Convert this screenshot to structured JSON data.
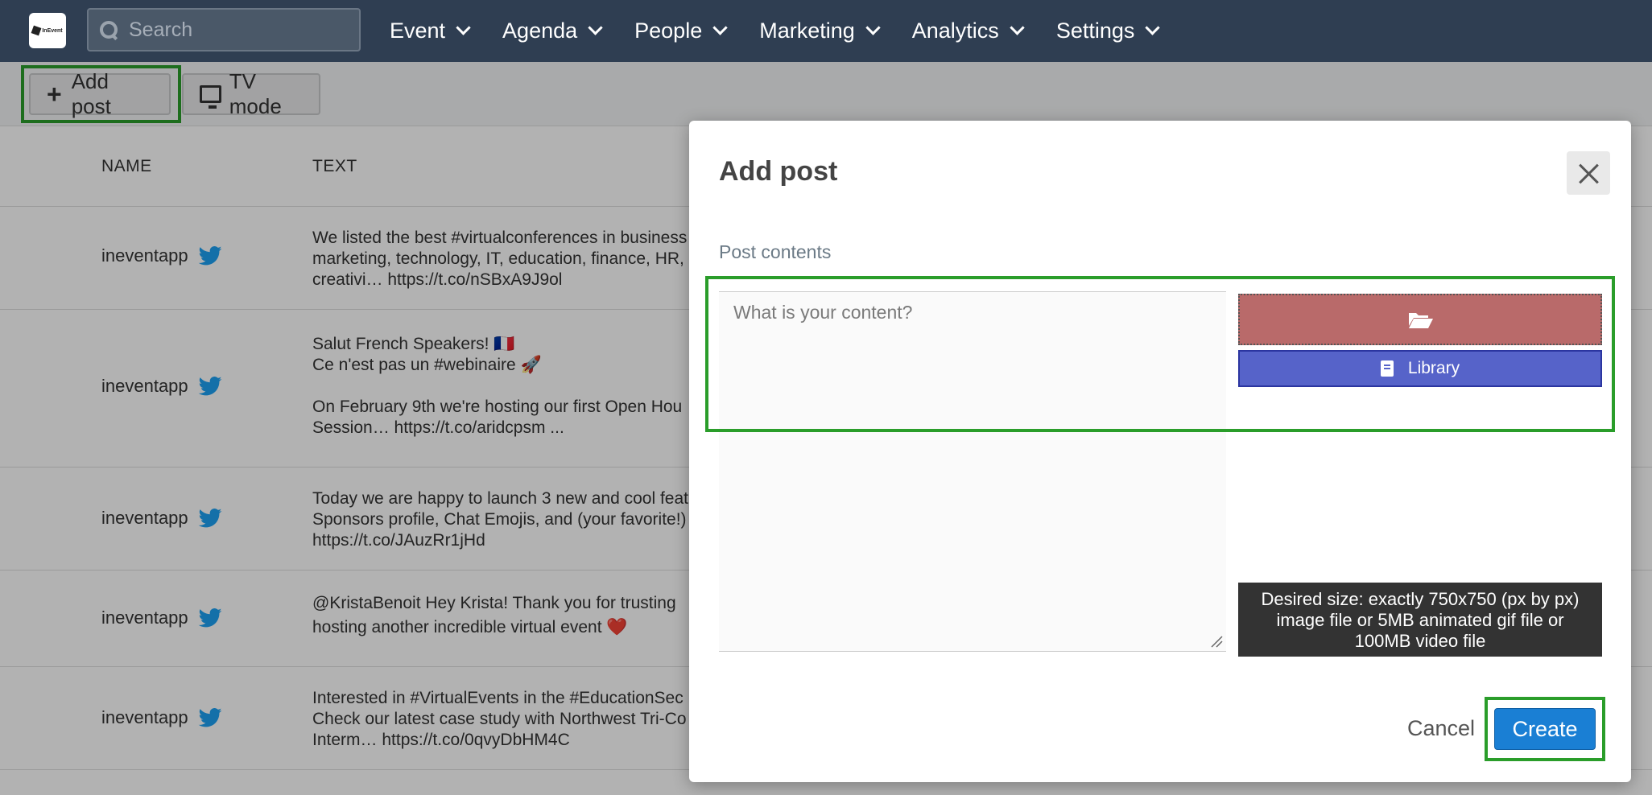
{
  "header": {
    "logo_text": "InEvent",
    "search_placeholder": "Search",
    "nav": [
      "Event",
      "Agenda",
      "People",
      "Marketing",
      "Analytics",
      "Settings"
    ]
  },
  "toolbar": {
    "add_post_label": "Add post",
    "tv_mode_label": "TV mode"
  },
  "table": {
    "columns": [
      "NAME",
      "TEXT"
    ],
    "rows": [
      {
        "name": "ineventapp",
        "text": "We listed the best #virtualconferences in business\nmarketing, technology, IT, education, finance, HR,\ncreativi… https://t.co/nSBxA9J9ol"
      },
      {
        "name": "ineventapp",
        "text": "Salut French Speakers! 🇫🇷\nCe n'est pas un #webinaire 🚀\n\nOn February 9th we're hosting our first Open Hou\nSession… https://t.co/aridcpsm ..."
      },
      {
        "name": "ineventapp",
        "text": "Today we are happy to launch 3 new and cool feat\nSponsors profile, Chat Emojis, and (your favorite!)\nhttps://t.co/JAuzRr1jHd"
      },
      {
        "name": "ineventapp",
        "text": "@KristaBenoit Hey Krista! Thank you for trusting\nhosting another incredible virtual event ❤️"
      },
      {
        "name": "ineventapp",
        "text": "Interested in #VirtualEvents in the #EducationSec\nCheck our latest case study with Northwest Tri-Co\nInterm… https://t.co/0qvyDbHM4C"
      }
    ]
  },
  "modal": {
    "title": "Add post",
    "section_label": "Post contents",
    "content_placeholder": "What is your content?",
    "content_value": "",
    "library_label": "Library",
    "hint": "Desired size: exactly 750x750 (px by px) image file or 5MB animated gif file or 100MB video file",
    "cancel_label": "Cancel",
    "create_label": "Create"
  },
  "colors": {
    "nav_bg": "#2f3e52",
    "highlight": "#2a9d2a",
    "upload": "#b96a6a",
    "library": "#5663c9",
    "create": "#1a7fd4",
    "twitter": "#1da1f2"
  },
  "icons": [
    "search-icon",
    "chevron-down-icon",
    "plus-icon",
    "tv-icon",
    "twitter-icon",
    "close-icon",
    "folder-open-icon",
    "book-icon"
  ]
}
